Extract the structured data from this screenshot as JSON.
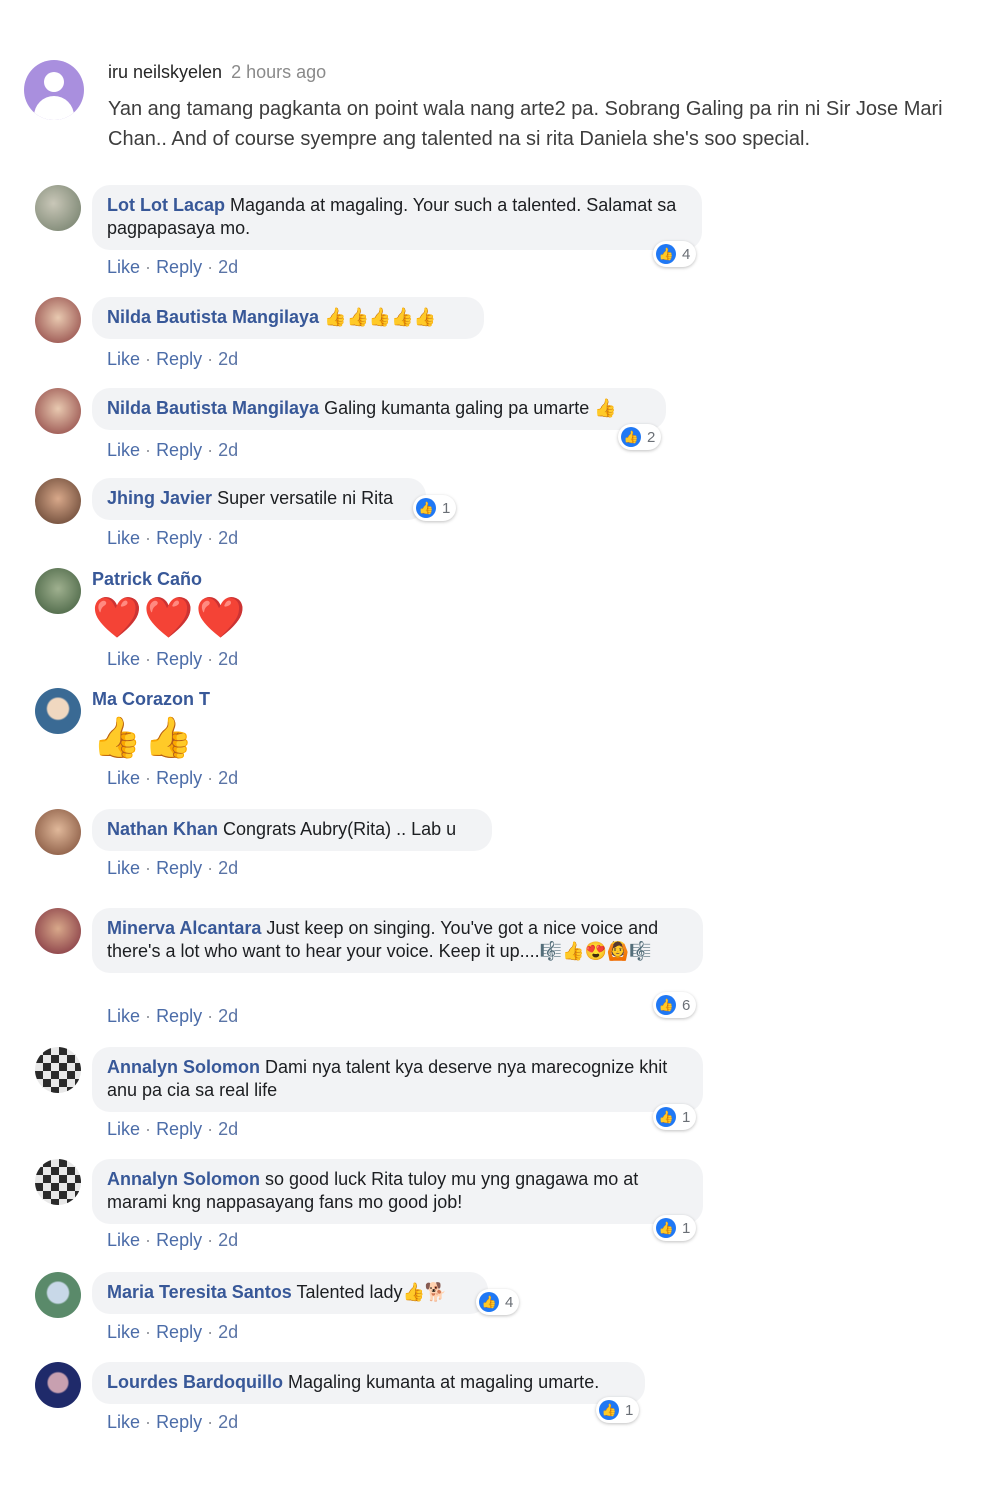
{
  "top_comment": {
    "author": "iru neilskyelen",
    "time": "2 hours ago",
    "text": "Yan ang tamang pagkanta on point wala nang arte2 pa. Sobrang Galing pa rin ni Sir Jose Mari Chan.. And of course syempre ang talented na si rita Daniela she's soo special."
  },
  "actions": {
    "like": "Like",
    "reply": "Reply",
    "sep": "·"
  },
  "replies": [
    {
      "author": "Lot Lot Lacap",
      "text": "Maganda at magaling. Your such a talented. Salamat sa pagpapasaya mo.",
      "time": "2d",
      "reactions": "4"
    },
    {
      "author": "Nilda Bautista Mangilaya",
      "text": "👍👍👍👍👍",
      "time": "2d",
      "reactions": ""
    },
    {
      "author": "Nilda Bautista Mangilaya",
      "text": "Galing kumanta galing pa umarte 👍",
      "time": "2d",
      "reactions": "2"
    },
    {
      "author": "Jhing Javier",
      "text": "Super versatile ni Rita",
      "time": "2d",
      "reactions": "1"
    },
    {
      "author": "Patrick Caño",
      "text": "❤️❤️❤️",
      "time": "2d",
      "reactions": ""
    },
    {
      "author": "Ma Corazon T",
      "text": "👍👍",
      "time": "2d",
      "reactions": ""
    },
    {
      "author": "Nathan Khan",
      "text": "Congrats Aubry(Rita) .. Lab u",
      "time": "2d",
      "reactions": ""
    },
    {
      "author": "Minerva Alcantara",
      "text": "Just keep on singing. You've got a nice voice and there's a lot who want to hear your voice. Keep it up....🎼👍😍🙆🎼",
      "time": "2d",
      "reactions": "6"
    },
    {
      "author": "Annalyn Solomon",
      "text": "Dami nya talent kya deserve nya marecognize khit anu pa cia sa real life",
      "time": "2d",
      "reactions": "1"
    },
    {
      "author": "Annalyn Solomon",
      "text": "so good luck Rita tuloy mu yng gnagawa mo at marami kng nappasayang fans mo good job!",
      "time": "2d",
      "reactions": "1"
    },
    {
      "author": "Maria Teresita Santos",
      "text": "Talented lady👍🐕",
      "time": "2d",
      "reactions": "4"
    },
    {
      "author": "Lourdes Bardoquillo",
      "text": "Magaling kumanta at magaling umarte.",
      "time": "2d",
      "reactions": "1"
    }
  ],
  "icons": {
    "like_reaction": "like-reaction-icon"
  },
  "colors": {
    "name": "#385898",
    "bubble": "#f2f3f5",
    "like_blue": "#2078f4"
  }
}
